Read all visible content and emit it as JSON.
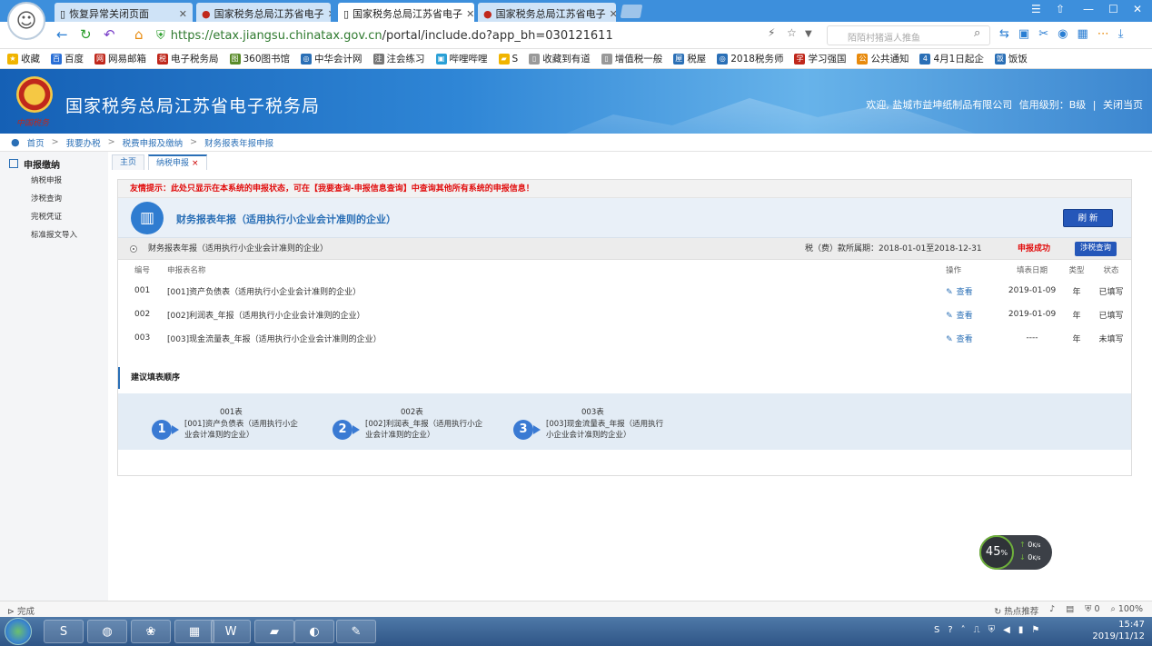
{
  "browser": {
    "tabs": [
      {
        "title": "恢复异常关闭页面",
        "close": "✕"
      },
      {
        "title": "国家税务总局江苏省电子",
        "close": "✕"
      },
      {
        "title": "国家税务总局江苏省电子",
        "close": "✕"
      },
      {
        "title": "国家税务总局江苏省电子",
        "close": "✕"
      }
    ],
    "url_main": "https://etax.jiangsu.chinatax.gov.cn",
    "url_tail": "/portal/include.do?app_bh=030121611",
    "search_placeholder": "陌陌村猪逼人推鱼",
    "bookmarks": [
      "收藏",
      "百度",
      "网易邮箱",
      "电子税务局",
      "360图书馆",
      "中华会计网",
      "注会练习",
      "哔哩哔哩",
      "S",
      "收藏到有道",
      "增值税一般",
      "税屋",
      "2018税务师",
      "学习强国",
      "公共通知",
      "4月1日起企",
      "饭饭"
    ],
    "status_left": "完成",
    "status_right": [
      "热点推荐",
      "0",
      "100%"
    ]
  },
  "site": {
    "title": "国家税务总局江苏省电子税务局",
    "emblem_text": "中国税务",
    "welcome": "欢迎, 盐城市益坤纸制品有限公司",
    "credit": "信用级别：B级",
    "sep": "|",
    "close": "关闭当页"
  },
  "breadcrumb": [
    "首页",
    "我要办税",
    "税费申报及缴纳",
    "财务报表年报申报"
  ],
  "breadcrumb_sep": ">",
  "sidebar": {
    "heading": "申报缴纳",
    "items": [
      "纳税申报",
      "涉税查询",
      "完税凭证",
      "标准报文导入"
    ]
  },
  "content_tabs": [
    {
      "label": "主页"
    },
    {
      "label": "纳税申报",
      "close": "×"
    }
  ],
  "notice": "友情提示：此处只显示在本系统的申报状态，可在【我要查询-申报信息查询】中查询其他所有系统的申报信息！",
  "header": {
    "title": "财务报表年报（适用执行小企业会计准则的企业）",
    "refresh": "刷 新"
  },
  "form_row": {
    "name": "财务报表年报（适用执行小企业会计准则的企业）",
    "period": "税（费）款所属期：2018-01-01至2018-12-31",
    "state": "申报成功",
    "query": "涉税查询"
  },
  "table": {
    "headers": [
      "编号",
      "申报表名称",
      "操作",
      "填表日期",
      "类型",
      "状态"
    ],
    "rows": [
      {
        "no": "001",
        "name": "[001]资产负债表（适用执行小企业会计准则的企业）",
        "op": "查看",
        "date": "2019-01-09",
        "type": "年",
        "status": "已填写"
      },
      {
        "no": "002",
        "name": "[002]利润表_年报（适用执行小企业会计准则的企业）",
        "op": "查看",
        "date": "2019-01-09",
        "type": "年",
        "status": "已填写"
      },
      {
        "no": "003",
        "name": "[003]现金流量表_年报（适用执行小企业会计准则的企业）",
        "op": "查看",
        "date": "----",
        "type": "年",
        "status": "未填写"
      }
    ]
  },
  "order": {
    "title": "建议填表顺序",
    "steps": [
      {
        "num": "1",
        "label": "001表",
        "desc": "[001]资产负债表（适用执行小企业会计准则的企业）"
      },
      {
        "num": "2",
        "label": "002表",
        "desc": "[002]利润表_年报（适用执行小企业会计准则的企业）"
      },
      {
        "num": "3",
        "label": "003表",
        "desc": "[003]现金流量表_年报（适用执行小企业会计准则的企业）"
      }
    ]
  },
  "speed": {
    "percent": "45",
    "unit": "%",
    "up": "0",
    "down": "0",
    "rate_unit": "K/s"
  },
  "taskbar": {
    "time": "15:47",
    "date": "2019/11/12"
  },
  "colors": {
    "accent": "#2a6fb6",
    "alert": "#e10c0c",
    "button": "#2557b9",
    "pending": "#e88a0c"
  }
}
